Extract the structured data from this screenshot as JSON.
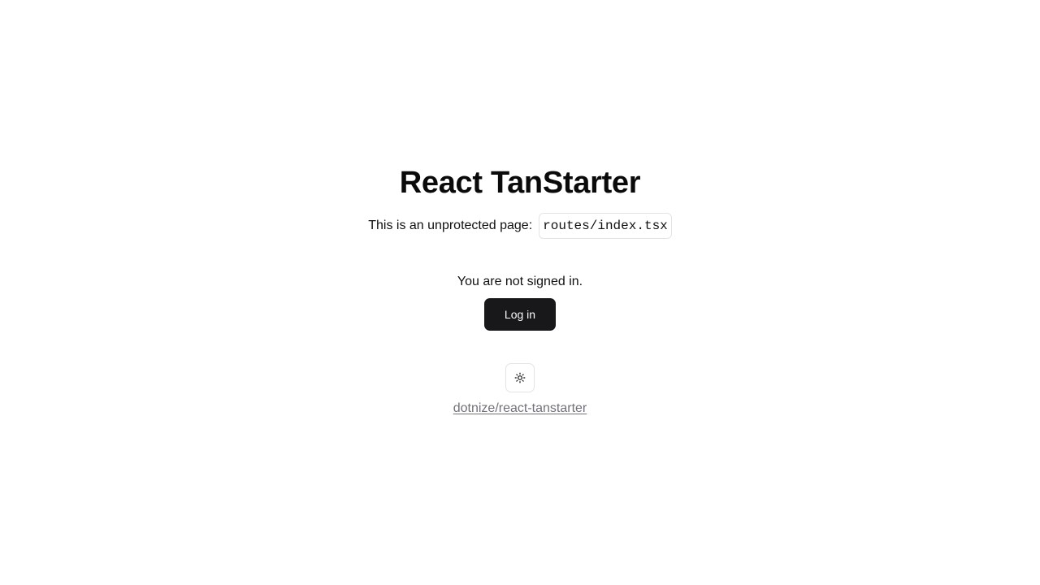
{
  "main": {
    "title": "React TanStarter",
    "subtitle": "This is an unprotected page:",
    "route_code": "routes/index.tsx",
    "signin_status": "You are not signed in.",
    "login_label": "Log in",
    "theme_toggle_icon": "sun-icon",
    "repo_link_text": "dotnize/react-tanstarter"
  },
  "colors": {
    "button_bg": "#18181b",
    "link": "#71717a",
    "border": "#e4e4e7"
  }
}
